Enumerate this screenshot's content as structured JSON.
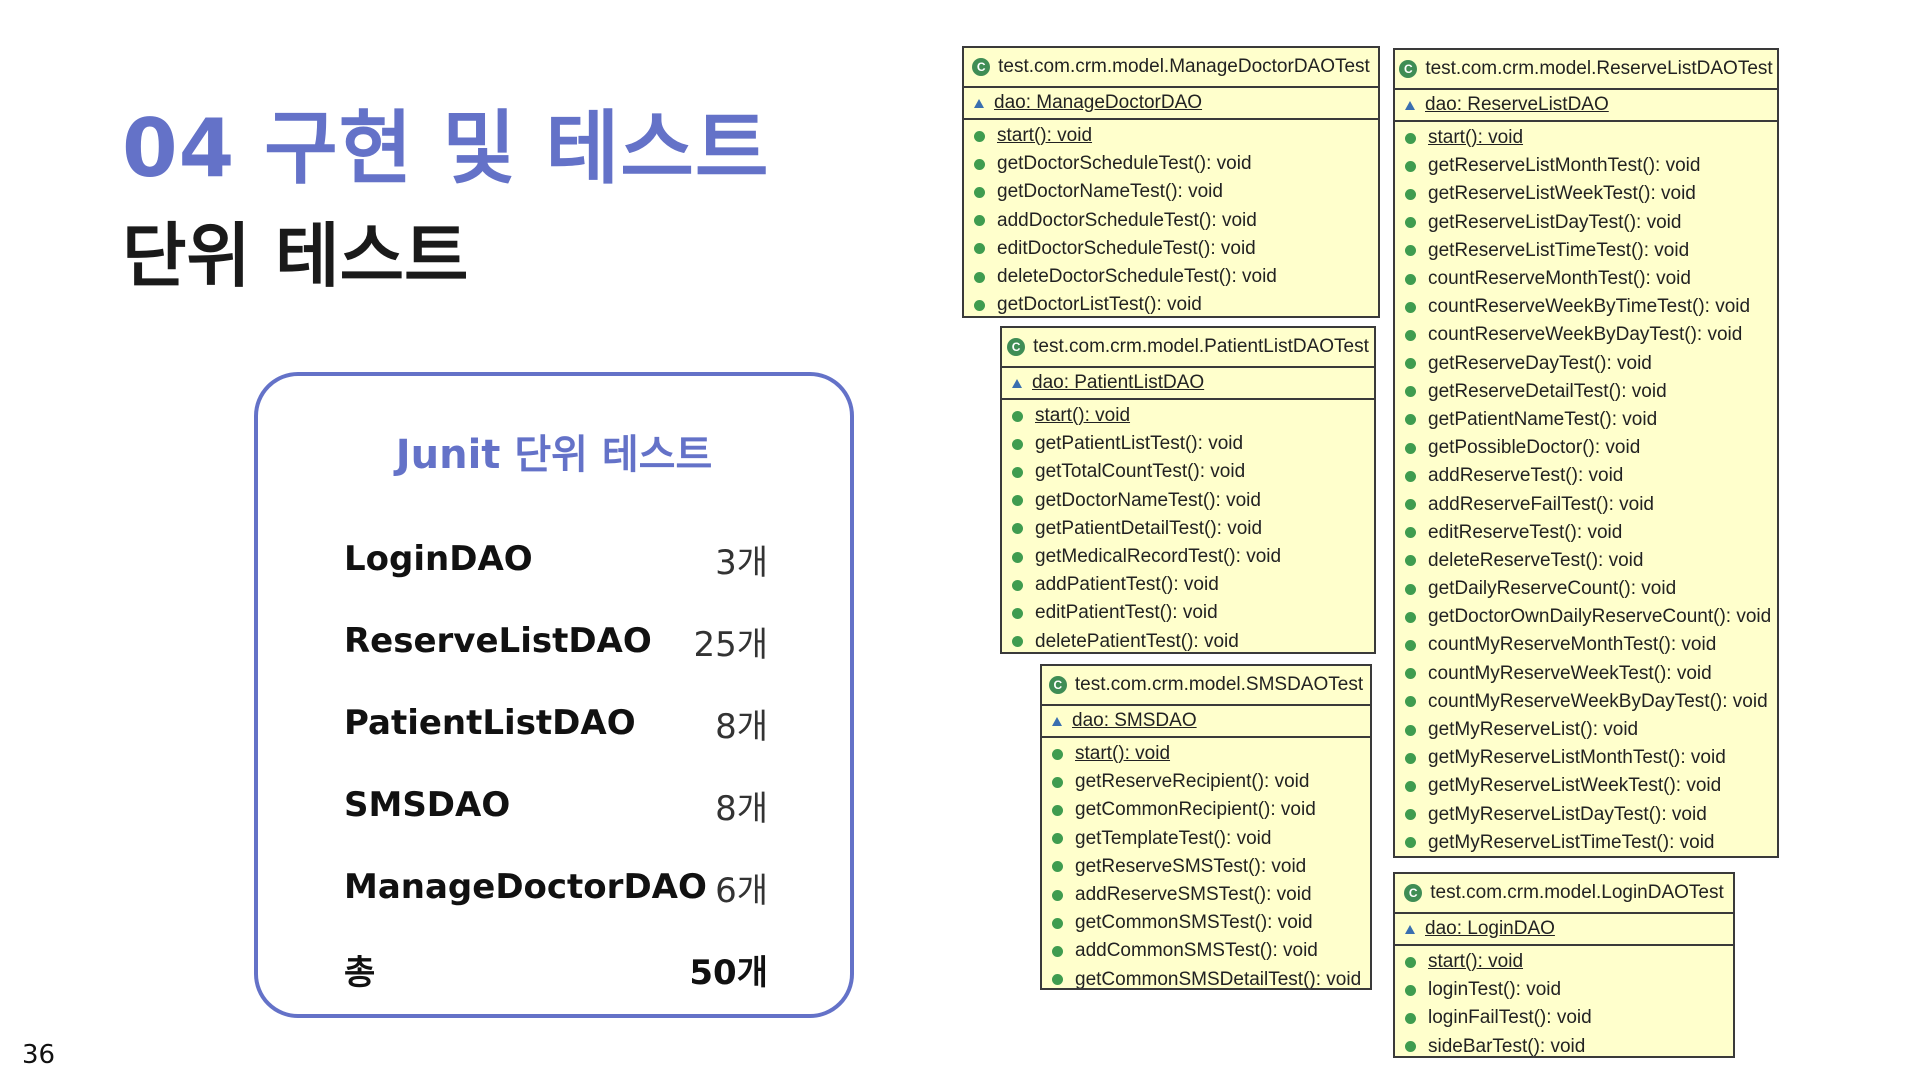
{
  "slide": {
    "title": "04 구현 및 테스트",
    "subtitle": "단위 테스트",
    "page_number": "36"
  },
  "summary": {
    "title": "Junit 단위 테스트",
    "rows": [
      {
        "label": "LoginDAO",
        "value": "3개"
      },
      {
        "label": "ReserveListDAO",
        "value": "25개"
      },
      {
        "label": "PatientListDAO",
        "value": "8개"
      },
      {
        "label": "SMSDAO",
        "value": "8개"
      },
      {
        "label": "ManageDoctorDAO",
        "value": "6개"
      }
    ],
    "total": {
      "label": "총",
      "value": "50개"
    }
  },
  "uml": {
    "class_icon": "class-c-icon",
    "field_icon": "protected-field-icon",
    "method_icon": "public-method-icon",
    "classes": {
      "manage_doctor": {
        "name": "test.com.crm.model.ManageDoctorDAOTest",
        "field": "dao: ManageDoctorDAO",
        "methods": [
          "start(): void",
          "getDoctorScheduleTest(): void",
          "getDoctorNameTest(): void",
          "addDoctorScheduleTest(): void",
          "editDoctorScheduleTest(): void",
          "deleteDoctorScheduleTest(): void",
          "getDoctorListTest(): void"
        ]
      },
      "patient_list": {
        "name": "test.com.crm.model.PatientListDAOTest",
        "field": "dao: PatientListDAO",
        "methods": [
          "start(): void",
          "getPatientListTest(): void",
          "getTotalCountTest(): void",
          "getDoctorNameTest(): void",
          "getPatientDetailTest(): void",
          "getMedicalRecordTest(): void",
          "addPatientTest(): void",
          "editPatientTest(): void",
          "deletePatientTest(): void"
        ]
      },
      "sms": {
        "name": "test.com.crm.model.SMSDAOTest",
        "field": "dao: SMSDAO",
        "methods": [
          "start(): void",
          "getReserveRecipient(): void",
          "getCommonRecipient(): void",
          "getTemplateTest(): void",
          "getReserveSMSTest(): void",
          "addReserveSMSTest(): void",
          "getCommonSMSTest(): void",
          "addCommonSMSTest(): void",
          "getCommonSMSDetailTest(): void"
        ]
      },
      "reserve_list": {
        "name": "test.com.crm.model.ReserveListDAOTest",
        "field": "dao: ReserveListDAO",
        "methods": [
          "start(): void",
          "getReserveListMonthTest(): void",
          "getReserveListWeekTest(): void",
          "getReserveListDayTest(): void",
          "getReserveListTimeTest(): void",
          "countReserveMonthTest(): void",
          "countReserveWeekByTimeTest(): void",
          "countReserveWeekByDayTest(): void",
          "getReserveDayTest(): void",
          "getReserveDetailTest(): void",
          "getPatientNameTest(): void",
          "getPossibleDoctor(): void",
          "addReserveTest(): void",
          "addReserveFailTest(): void",
          "editReserveTest(): void",
          "deleteReserveTest(): void",
          "getDailyReserveCount(): void",
          "getDoctorOwnDailyReserveCount(): void",
          "countMyReserveMonthTest(): void",
          "countMyReserveWeekTest(): void",
          "countMyReserveWeekByDayTest(): void",
          "getMyReserveList(): void",
          "getMyReserveListMonthTest(): void",
          "getMyReserveListWeekTest(): void",
          "getMyReserveListDayTest(): void",
          "getMyReserveListTimeTest(): void"
        ]
      },
      "login": {
        "name": "test.com.crm.model.LoginDAOTest",
        "field": "dao: LoginDAO",
        "methods": [
          "start(): void",
          "loginTest(): void",
          "loginFailTest(): void",
          "sideBarTest(): void"
        ]
      }
    }
  }
}
